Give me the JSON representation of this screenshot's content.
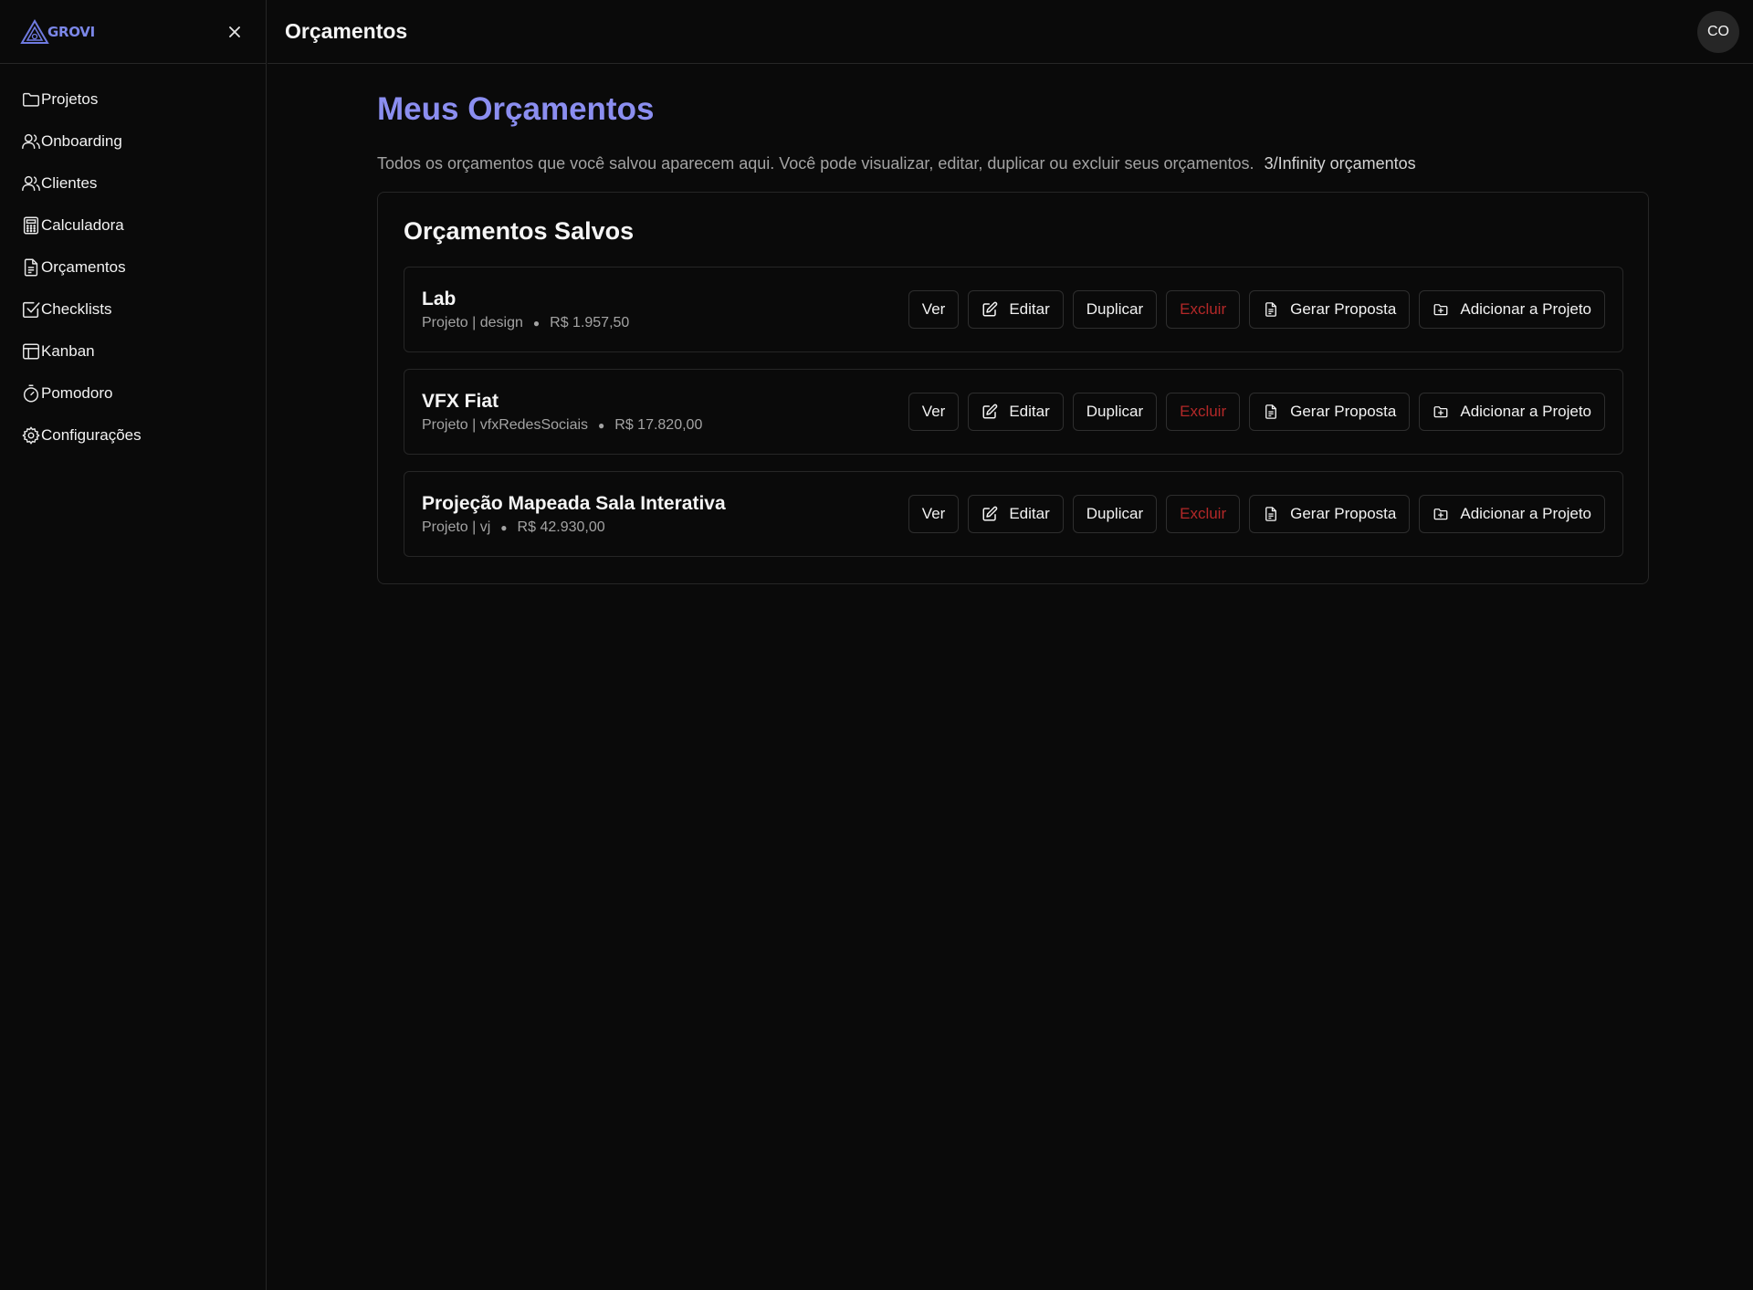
{
  "app": {
    "logo_text": "GROVI",
    "accent": "#8b8ef0",
    "danger": "#b32828"
  },
  "sidebar": {
    "items": [
      {
        "label": "Projetos",
        "icon": "folder-icon"
      },
      {
        "label": "Onboarding",
        "icon": "user-plus-icon"
      },
      {
        "label": "Clientes",
        "icon": "users-icon"
      },
      {
        "label": "Calculadora",
        "icon": "calculator-icon"
      },
      {
        "label": "Orçamentos",
        "icon": "file-text-icon"
      },
      {
        "label": "Checklists",
        "icon": "check-square-icon"
      },
      {
        "label": "Kanban",
        "icon": "layout-icon"
      },
      {
        "label": "Pomodoro",
        "icon": "timer-icon"
      },
      {
        "label": "Configurações",
        "icon": "gear-icon"
      }
    ]
  },
  "header": {
    "title": "Orçamentos",
    "avatar_initials": "CO"
  },
  "main": {
    "title": "Meus Orçamentos",
    "description": "Todos os orçamentos que você salvou aparecem aqui. Você pode visualizar, editar, duplicar ou excluir seus orçamentos.",
    "quota": "3/Infinity orçamentos",
    "card_title": "Orçamentos Salvos",
    "actions": {
      "view": "Ver",
      "edit": "Editar",
      "duplicate": "Duplicar",
      "delete": "Excluir",
      "proposal": "Gerar Proposta",
      "add_to_project": "Adicionar a Projeto"
    },
    "budgets": [
      {
        "name": "Lab",
        "type": "Projeto | design",
        "value": "R$ 1.957,50"
      },
      {
        "name": "VFX Fiat",
        "type": "Projeto | vfxRedesSociais",
        "value": "R$ 17.820,00"
      },
      {
        "name": "Projeção Mapeada Sala Interativa",
        "type": "Projeto | vj",
        "value": "R$ 42.930,00"
      }
    ]
  }
}
